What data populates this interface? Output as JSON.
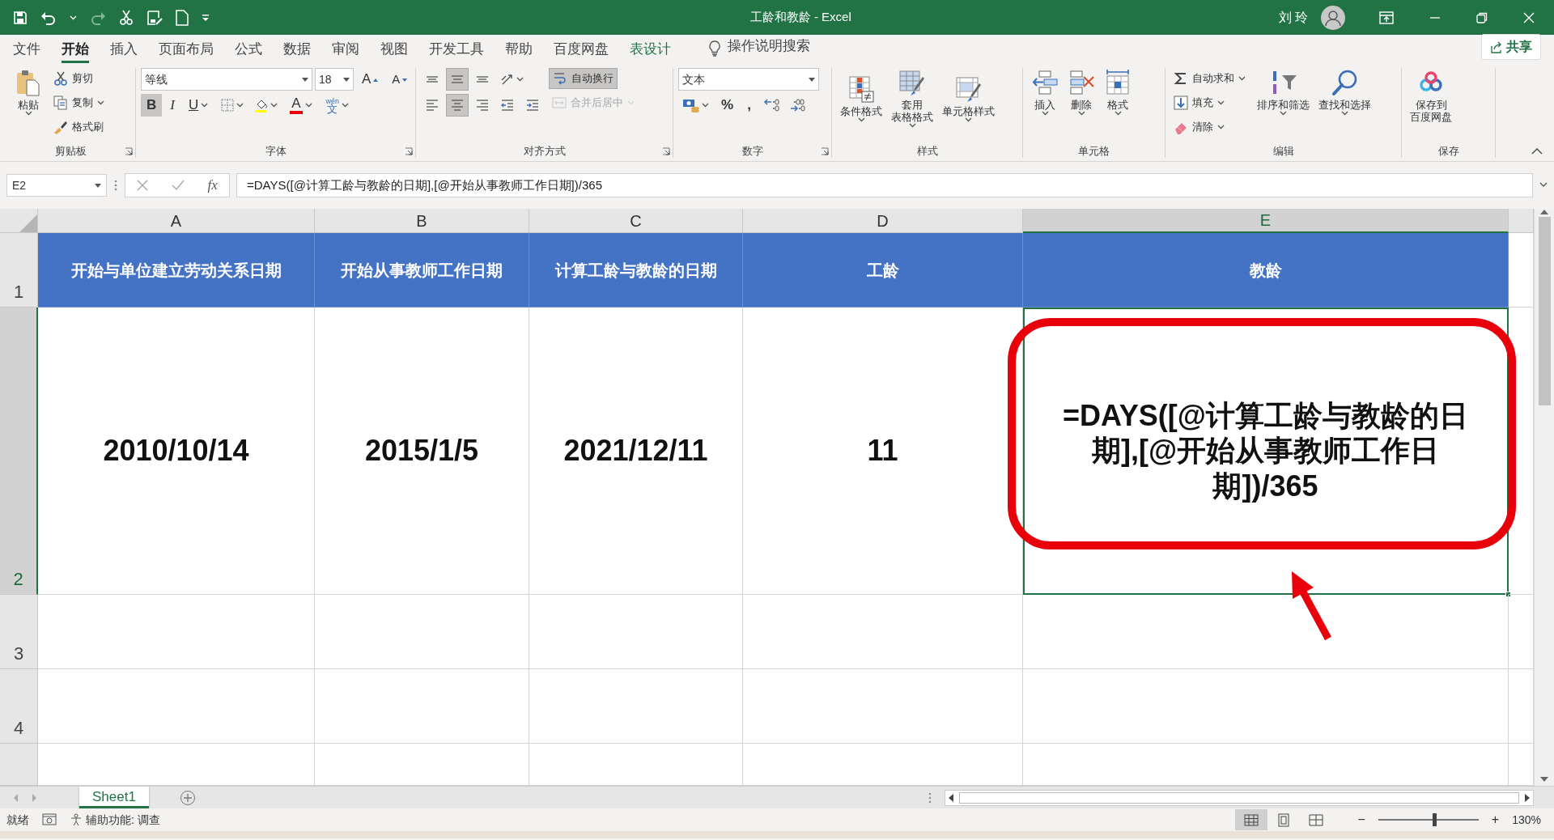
{
  "title_bar": {
    "title": "工龄和教龄  -  Excel",
    "user": "刘 玲"
  },
  "tabs": [
    {
      "label": "文件",
      "selected": false,
      "contextual": false
    },
    {
      "label": "开始",
      "selected": true,
      "contextual": false
    },
    {
      "label": "插入",
      "selected": false,
      "contextual": false
    },
    {
      "label": "页面布局",
      "selected": false,
      "contextual": false
    },
    {
      "label": "公式",
      "selected": false,
      "contextual": false
    },
    {
      "label": "数据",
      "selected": false,
      "contextual": false
    },
    {
      "label": "审阅",
      "selected": false,
      "contextual": false
    },
    {
      "label": "视图",
      "selected": false,
      "contextual": false
    },
    {
      "label": "开发工具",
      "selected": false,
      "contextual": false
    },
    {
      "label": "帮助",
      "selected": false,
      "contextual": false
    },
    {
      "label": "百度网盘",
      "selected": false,
      "contextual": false
    },
    {
      "label": "表设计",
      "selected": false,
      "contextual": true
    }
  ],
  "tell_me": "操作说明搜索",
  "share_button": "共享",
  "ribbon": {
    "groups": [
      {
        "label": "剪贴板",
        "launcher": true,
        "sections": [
          {
            "rows": [
              [
                {
                  "kind": "large",
                  "label": "粘贴",
                  "dropdown": true
                }
              ]
            ]
          },
          {
            "rows": [
              [
                {
                  "kind": "small",
                  "label": "剪切",
                  "dropdown": false,
                  "selected": false,
                  "disabled": false
                }
              ],
              [
                {
                  "kind": "small",
                  "label": "复制",
                  "dropdown": true,
                  "selected": false,
                  "disabled": false
                }
              ],
              [
                {
                  "kind": "small",
                  "label": "格式刷",
                  "dropdown": false,
                  "selected": false,
                  "disabled": false
                }
              ]
            ]
          }
        ]
      },
      {
        "label": "字体",
        "launcher": true,
        "sections": [
          {
            "rows": [
              [
                {
                  "kind": "font-combo",
                  "value": "等线"
                },
                {
                  "kind": "size-combo",
                  "value": "18"
                },
                {
                  "kind": "grow-font",
                  "label": "A"
                },
                {
                  "kind": "shrink-font",
                  "label": "A"
                }
              ],
              [
                {
                  "kind": "glyph",
                  "label": "B",
                  "selected": true,
                  "dropdown": false
                },
                {
                  "kind": "glyph",
                  "label": "I",
                  "selected": false,
                  "dropdown": false
                },
                {
                  "kind": "glyph",
                  "label": "U",
                  "selected": false,
                  "dropdown": true
                },
                {
                  "kind": "icon",
                  "selected": false,
                  "disabled": false,
                  "dropdown": true
                },
                {
                  "kind": "icon",
                  "selected": false,
                  "disabled": false,
                  "dropdown": true
                },
                {
                  "kind": "color-glyph",
                  "label": "A",
                  "dropdown": true
                },
                {
                  "kind": "ruby",
                  "top": "wén",
                  "label": "文",
                  "dropdown": true
                }
              ]
            ]
          }
        ]
      },
      {
        "label": "对齐方式",
        "launcher": true,
        "sections": [
          {
            "rows": [
              [
                {
                  "kind": "icon",
                  "selected": false,
                  "disabled": false,
                  "dropdown": false
                },
                {
                  "kind": "icon",
                  "selected": true,
                  "disabled": false,
                  "dropdown": false
                },
                {
                  "kind": "icon",
                  "selected": false,
                  "disabled": false,
                  "dropdown": false
                },
                {
                  "kind": "icon",
                  "selected": false,
                  "disabled": false,
                  "dropdown": true
                }
              ],
              [
                {
                  "kind": "icon",
                  "selected": false,
                  "disabled": false,
                  "dropdown": false
                },
                {
                  "kind": "icon",
                  "selected": true,
                  "disabled": false,
                  "dropdown": false
                },
                {
                  "kind": "icon",
                  "selected": false,
                  "disabled": false,
                  "dropdown": false
                },
                {
                  "kind": "icon",
                  "selected": false,
                  "disabled": false,
                  "dropdown": false
                },
                {
                  "kind": "icon",
                  "selected": false,
                  "disabled": false,
                  "dropdown": false
                }
              ]
            ]
          },
          {
            "rows": [
              [
                {
                  "kind": "small",
                  "label": "自动换行",
                  "dropdown": false,
                  "selected": true,
                  "disabled": false
                }
              ],
              [
                {
                  "kind": "small",
                  "label": "合并后居中",
                  "dropdown": true,
                  "selected": false,
                  "disabled": true
                }
              ]
            ]
          }
        ]
      },
      {
        "label": "数字",
        "launcher": true,
        "sections": [
          {
            "rows": [
              [
                {
                  "kind": "format-combo",
                  "value": "文本"
                }
              ],
              [
                {
                  "kind": "icon",
                  "selected": false,
                  "disabled": false,
                  "dropdown": true
                },
                {
                  "kind": "glyph",
                  "label": "%",
                  "selected": false,
                  "dropdown": false
                },
                {
                  "kind": "glyph",
                  "label": ",",
                  "selected": false,
                  "dropdown": false
                },
                {
                  "kind": "icon",
                  "selected": false,
                  "disabled": false,
                  "dropdown": false
                },
                {
                  "kind": "icon",
                  "selected": false,
                  "disabled": false,
                  "dropdown": false
                }
              ]
            ]
          }
        ]
      },
      {
        "label": "样式",
        "launcher": false,
        "sections": [
          {
            "rows": [
              [
                {
                  "kind": "large",
                  "label": "条件格式",
                  "dropdown": true
                },
                {
                  "kind": "large",
                  "lines": [
                    "套用",
                    "表格格式"
                  ],
                  "dropdown": true
                },
                {
                  "kind": "large",
                  "label": "单元格样式",
                  "dropdown": true
                }
              ]
            ]
          }
        ]
      },
      {
        "label": "单元格",
        "launcher": false,
        "sections": [
          {
            "rows": [
              [
                {
                  "kind": "large",
                  "label": "插入",
                  "dropdown": true
                },
                {
                  "kind": "large",
                  "label": "删除",
                  "dropdown": true
                },
                {
                  "kind": "large",
                  "label": "格式",
                  "dropdown": true
                }
              ]
            ]
          }
        ]
      },
      {
        "label": "编辑",
        "launcher": false,
        "sections": [
          {
            "rows": [
              [
                {
                  "kind": "small",
                  "label": "自动求和",
                  "dropdown": true,
                  "selected": false,
                  "disabled": false
                }
              ],
              [
                {
                  "kind": "small",
                  "label": "填充",
                  "dropdown": true,
                  "selected": false,
                  "disabled": false
                }
              ],
              [
                {
                  "kind": "small",
                  "label": "清除",
                  "dropdown": true,
                  "selected": false,
                  "disabled": false
                }
              ]
            ]
          },
          {
            "rows": [
              [
                {
                  "kind": "large",
                  "label": "排序和筛选",
                  "dropdown": true
                },
                {
                  "kind": "large",
                  "label": "查找和选择",
                  "dropdown": true
                }
              ]
            ]
          }
        ]
      },
      {
        "label": "保存",
        "launcher": false,
        "sections": [
          {
            "rows": [
              [
                {
                  "kind": "large",
                  "lines": [
                    "保存到",
                    "百度网盘"
                  ],
                  "dropdown": false
                }
              ]
            ]
          }
        ]
      }
    ]
  },
  "formula_bar": {
    "name_box": "E2",
    "function_label": "fx",
    "formula": "=DAYS([@计算工龄与教龄的日期],[@开始从事教师工作日期])/365"
  },
  "sheet": {
    "columns": [
      {
        "label": "A",
        "selected": false
      },
      {
        "label": "B",
        "selected": false
      },
      {
        "label": "C",
        "selected": false
      },
      {
        "label": "D",
        "selected": false
      },
      {
        "label": "E",
        "selected": true
      }
    ],
    "rows": [
      {
        "number": "1",
        "kind": "header",
        "selected": false,
        "cells": [
          {
            "text": "开始与单位建立劳动关系日期",
            "selected": false
          },
          {
            "text": "开始从事教师工作日期",
            "selected": false
          },
          {
            "text": "计算工龄与教龄的日期",
            "selected": false
          },
          {
            "text": "工龄",
            "selected": false
          },
          {
            "text": "教龄",
            "selected": false
          }
        ]
      },
      {
        "number": "2",
        "kind": "data",
        "selected": true,
        "cells": [
          {
            "text": "2010/10/14",
            "selected": false
          },
          {
            "text": "2015/1/5",
            "selected": false
          },
          {
            "text": "2021/12/11",
            "selected": false
          },
          {
            "text": "11",
            "selected": false
          },
          {
            "text": "=DAYS([@计算工龄与教龄的日期],[@开始从事教师工作日期])/365",
            "selected": true
          }
        ]
      },
      {
        "number": "3",
        "kind": "data",
        "selected": false
      },
      {
        "number": "4",
        "kind": "data",
        "selected": false
      }
    ]
  },
  "annotation": {
    "kind": "frame-and-arrow"
  },
  "sheet_tabs": [
    {
      "label": "Sheet1",
      "selected": true
    }
  ],
  "status_bar": {
    "ready": "就绪",
    "accessibility": "辅助功能: 调查",
    "views": [
      {
        "selected": true
      },
      {
        "selected": false
      },
      {
        "selected": false
      }
    ],
    "zoom_out": "−",
    "zoom_in": "+",
    "zoom": {
      "level": 0.56,
      "label": "130%"
    }
  }
}
